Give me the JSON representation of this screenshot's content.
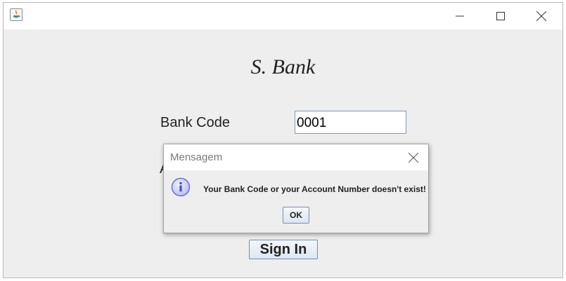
{
  "app": {
    "title": "S. Bank"
  },
  "form": {
    "bank_code_label": "Bank Code",
    "bank_code_value": "0001",
    "account_label_visible": "A",
    "sign_in_label": "Sign In"
  },
  "dialog": {
    "title": "Mensagem",
    "message": "Your Bank Code or your Account Number doesn't exist!",
    "ok_label": "OK",
    "icon": "info-icon"
  },
  "window_controls": {
    "icons": [
      "java-app-icon",
      "minimize-icon",
      "maximize-icon",
      "close-icon"
    ]
  },
  "colors": {
    "accent": "#7a9cc4",
    "info_icon": "#6b6fd6",
    "background": "#eeeeee"
  }
}
